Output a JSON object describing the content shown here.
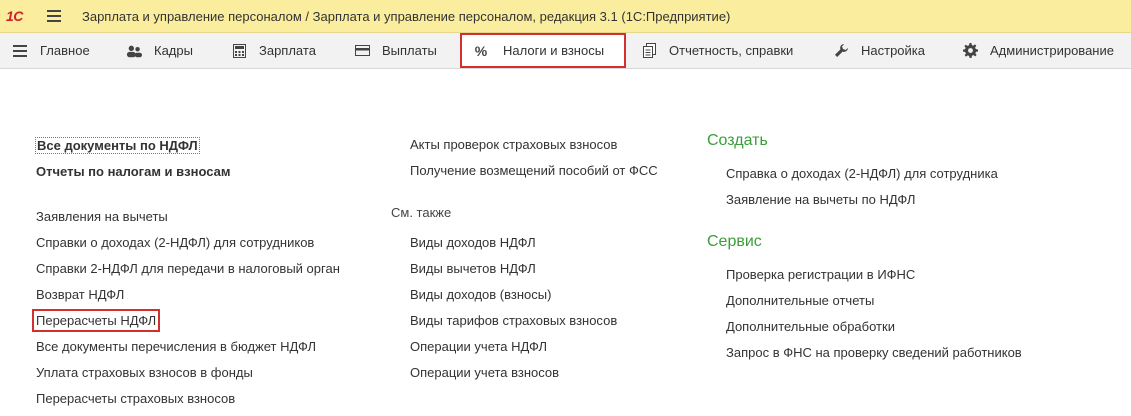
{
  "window": {
    "title": "Зарплата и управление персоналом / Зарплата и управление персоналом, редакция 3.1  (1С:Предприятие)",
    "logo_text": "1С"
  },
  "sections": [
    {
      "label": "Главное",
      "icon": "menu-icon"
    },
    {
      "label": "Кадры",
      "icon": "people-icon"
    },
    {
      "label": "Зарплата",
      "icon": "calculator-icon"
    },
    {
      "label": "Выплаты",
      "icon": "wallet-icon"
    },
    {
      "label": "Налоги и взносы",
      "icon": "percent-icon",
      "active": true
    },
    {
      "label": "Отчетность, справки",
      "icon": "documents-icon"
    },
    {
      "label": "Настройка",
      "icon": "wrench-icon"
    },
    {
      "label": "Администрирование",
      "icon": "gear-icon"
    }
  ],
  "col1": {
    "top_links": [
      "Все документы по НДФЛ",
      "Отчеты по налогам и взносам"
    ],
    "links": [
      "Заявления на вычеты",
      "Справки о доходах (2-НДФЛ) для сотрудников",
      "Справки 2-НДФЛ для передачи в налоговый орган",
      "Возврат НДФЛ",
      "Перерасчеты НДФЛ",
      "Все документы перечисления в бюджет НДФЛ",
      "Уплата страховых взносов в фонды",
      "Перерасчеты страховых взносов"
    ]
  },
  "col2": {
    "links": [
      "Акты проверок страховых взносов",
      "Получение возмещений пособий от ФСС"
    ],
    "see_also_caption": "См. также",
    "see_also": [
      "Виды доходов НДФЛ",
      "Виды вычетов НДФЛ",
      "Виды доходов (взносы)",
      "Виды тарифов страховых взносов",
      "Операции учета НДФЛ",
      "Операции учета взносов"
    ]
  },
  "col3": {
    "create_title": "Создать",
    "create": [
      "Справка о доходах (2-НДФЛ) для сотрудника",
      "Заявление на вычеты по НДФЛ"
    ],
    "service_title": "Сервис",
    "service": [
      "Проверка регистрации в ИФНС",
      "Дополнительные отчеты",
      "Дополнительные обработки",
      "Запрос в ФНС на проверку сведений работников"
    ]
  },
  "colors": {
    "titlebar": "#fbed9e",
    "section_heading": "#3a9d3a",
    "highlight": "#d32f2f"
  }
}
